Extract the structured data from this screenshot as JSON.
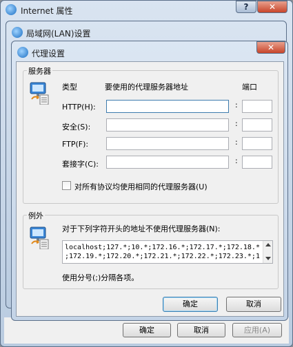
{
  "window_internet": {
    "title": "Internet 属性",
    "help": "?",
    "close": "✕",
    "buttons": {
      "ok": "确定",
      "cancel": "取消",
      "apply": "应用(A)"
    }
  },
  "window_lan": {
    "title": "局域网(LAN)设置"
  },
  "window_proxy": {
    "title": "代理设置",
    "close": "✕",
    "servers": {
      "legend": "服务器",
      "col_type": "类型",
      "col_address": "要使用的代理服务器地址",
      "col_port": "端口",
      "rows": [
        {
          "label": "HTTP(H):",
          "address": "",
          "port": ""
        },
        {
          "label": "安全(S):",
          "address": "",
          "port": ""
        },
        {
          "label": "FTP(F):",
          "address": "",
          "port": ""
        },
        {
          "label": "套接字(C):",
          "address": "",
          "port": ""
        }
      ],
      "colon": ":",
      "same_proxy_label": "对所有协议均使用相同的代理服务器(U)",
      "same_proxy_checked": false
    },
    "exceptions": {
      "legend": "例外",
      "description": "对于下列字符开头的地址不使用代理服务器(N):",
      "text_line1": "localhost;127.*;10.*;172.16.*;172.17.*;172.18.*",
      "text_line2": ";172.19.*;172.20.*;172.21.*;172.22.*;172.23.*;1",
      "hint": "使用分号(;)分隔各项。"
    },
    "buttons": {
      "ok": "确定",
      "cancel": "取消"
    }
  }
}
